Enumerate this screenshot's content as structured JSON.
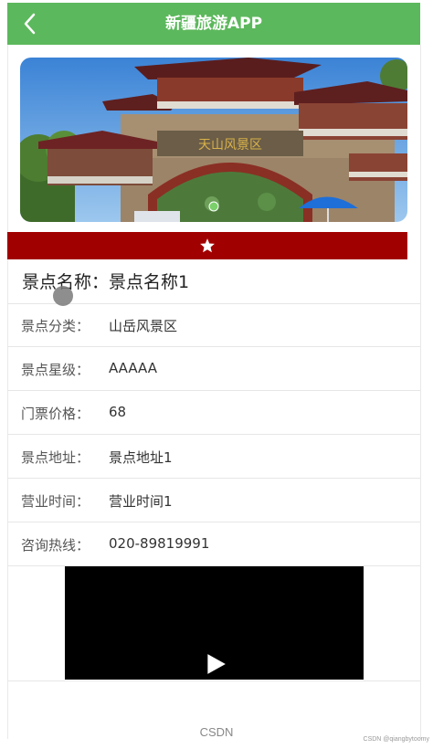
{
  "header": {
    "title": "新疆旅游APP",
    "back_icon": "chevron-left-icon",
    "color": "#5cb85c"
  },
  "photo": {
    "gate_sign": "天山风景区"
  },
  "favorite": {
    "icon": "star-icon",
    "bar_color": "#a10000"
  },
  "spot": {
    "name_label": "景点名称：",
    "name_value": "景点名称1"
  },
  "details": [
    {
      "label": "景点分类：",
      "value": "山岳风景区"
    },
    {
      "label": "景点星级：",
      "value": "AAAAA"
    },
    {
      "label": "门票价格：",
      "value": "68"
    },
    {
      "label": "景点地址：",
      "value": "景点地址1"
    },
    {
      "label": "营业时间：",
      "value": "营业时间1"
    },
    {
      "label": "咨询热线：",
      "value": "020-89819991"
    }
  ],
  "video": {
    "play_icon": "play-icon"
  },
  "watermark": {
    "center": "CSDN",
    "right": "CSDN @qiangbytoomy"
  }
}
